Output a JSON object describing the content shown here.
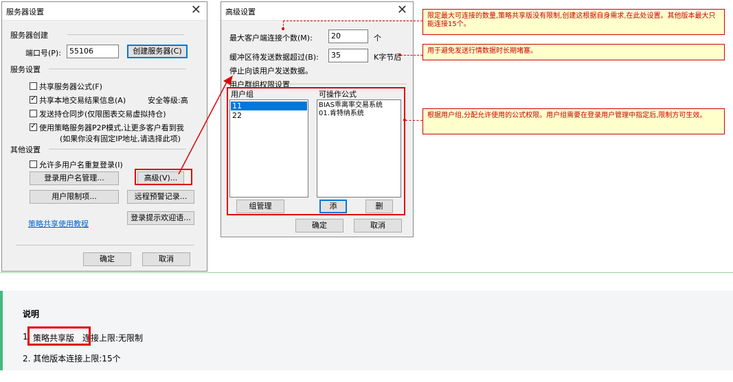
{
  "server_dialog": {
    "title": "服务器设置",
    "section_create": "服务器创建",
    "port_label": "端口号(P):",
    "port_value": "55106",
    "create_button": "创建服务器(C)",
    "section_settings": "服务设置",
    "share_formula": "共享服务器公式(F)",
    "share_local": "共享本地交易结果信息(A)",
    "security_level": "安全等级:高",
    "sync_position": "发送持仓同步(仅限图表交易虚拟持仓)",
    "p2p_mode": "使用策略服务器P2P模式,让更多客户看到我",
    "p2p_note": "(如果你没有固定IP地址,请选择此项)",
    "section_other": "其他设置",
    "allow_dup_login": "允许多用户名重复登录(I)",
    "login_user_mgmt": "登录用户名管理...",
    "advanced": "高级(V)...",
    "user_limit": "用户限制项...",
    "remote_alert": "远程预警记录...",
    "login_welcome": "登录提示欢迎语...",
    "tutorial_link": "策略共享使用教程",
    "ok": "确定",
    "cancel": "取消",
    "checkbox_states": {
      "share_formula": false,
      "share_local": true,
      "sync_position": false,
      "p2p_mode": true,
      "allow_dup_login": false
    }
  },
  "advanced_dialog": {
    "title": "高级设置",
    "max_clients_label": "最大客户端连接个数(M):",
    "max_clients_value": "20",
    "max_clients_unit": "个",
    "buffer_label": "缓冲区待发送数据超过(B):",
    "buffer_value": "35",
    "buffer_unit": "K字节后",
    "buffer_suffix": "停止向该用户发送数据。",
    "group_section": "用户群组权限设置",
    "user_group_header": "用户组",
    "formula_header": "可操作公式",
    "user_groups": [
      "11",
      "22"
    ],
    "formulas": [
      "BIAS乖离率交易系统",
      "01.肯特纳系统"
    ],
    "group_manage": "组管理",
    "add": "添",
    "delete": "删",
    "ok": "确定",
    "cancel": "取消"
  },
  "annotations": {
    "note1": "限定最大可连接的数量,策略共享版没有限制,创建这根据自身需求,在此处设置。其他版本最大只能连接15个。",
    "note2": "用于避免发送行情数据时长期堵塞。",
    "note3": "根据用户组,分配允许使用的公式权限。用户组需要在登录用户管理中指定后,限制方可生效。"
  },
  "explanation": {
    "title": "说明",
    "item1_num": "1.",
    "item1_highlight": "策略共享版",
    "item1_rest": "连接上限:无限制",
    "item2": "2. 其他版本连接上限:15个"
  },
  "colors": {
    "accent_red": "#e00000",
    "note_bg": "#ffffcc",
    "panel_green": "#42b983"
  }
}
